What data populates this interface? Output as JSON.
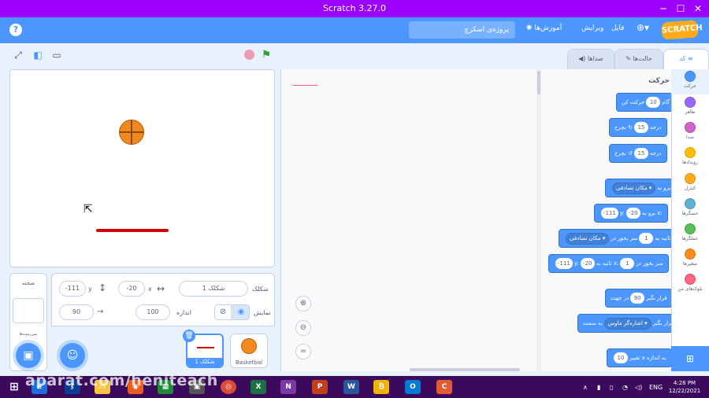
{
  "window": {
    "title": "Scratch 3.27.0",
    "minimize": "─",
    "maximize": "☐",
    "close": "✕"
  },
  "menu": {
    "help_icon": "?",
    "project_name": "پروژه‌ی اسکرچ",
    "tutorials": "آموزش‌ها",
    "edit": "ویرایش",
    "file": "فایل",
    "language_icon": "globe-icon",
    "logo": "SCRATCH"
  },
  "tabs": {
    "code": "کد",
    "costumes": "حالت‌ها",
    "sounds": "صداها"
  },
  "stage_controls": {
    "full_icon": "fullscreen-icon",
    "small_icon": "small-stage-icon",
    "large_icon": "large-stage-icon",
    "stop_icon": "stop-icon",
    "flag_icon": "green-flag-icon"
  },
  "sprite_info": {
    "sprite_label": "شکلک",
    "sprite_name": "شکلک 1",
    "x_label": "x",
    "x_value": "-20",
    "y_label": "y",
    "y_value": "-111",
    "show_label": "نمایش",
    "size_label": "اندازه",
    "size_value": "100",
    "direction_label": "جهت",
    "direction_value": "90"
  },
  "sprites": [
    {
      "name": "شکلک 1",
      "selected": true
    },
    {
      "name": "Basketbal",
      "selected": false
    }
  ],
  "stage_pane": {
    "label": "صحنه",
    "backdrops_label": "پس‌زمینه‌ها"
  },
  "category_header": "حرکت",
  "blocks": [
    {
      "pre": "حرکت کن",
      "pill": "10",
      "post": "گام"
    },
    {
      "pre": "بچرخ",
      "icon": "↻",
      "pill": "15",
      "post": "درجه"
    },
    {
      "pre": "بچرخ",
      "icon": "↺",
      "pill": "15",
      "post": "درجه"
    },
    {
      "pre": "برو به",
      "dd": "مکان تصادفی"
    },
    {
      "pre": "برو به x:",
      "pill": "-20",
      "mid": "y:",
      "pill2": "-111"
    },
    {
      "pre": "سر بخور در",
      "pill": "1",
      "mid": "ثانیه به",
      "dd": "مکان تصادفی"
    },
    {
      "pre": "سر بخور در",
      "pill": "1",
      "mid": "ثانیه به x:",
      "pill2": "-20",
      "mid2": "y:",
      "pill3": "-111"
    },
    {
      "pre": "در جهت",
      "pill": "90",
      "post": "قرار بگیر"
    },
    {
      "pre": "به سمت",
      "dd": "اشاره‌گر ماوس",
      "post": "قرار بگیر"
    },
    {
      "pre": "تغییر x به اندازه",
      "pill": "10"
    }
  ],
  "categories": [
    {
      "name": "حرکت",
      "color": "#4c97ff"
    },
    {
      "name": "ظاهر",
      "color": "#9966ff"
    },
    {
      "name": "صدا",
      "color": "#cf63cf"
    },
    {
      "name": "رویدادها",
      "color": "#ffbf00"
    },
    {
      "name": "کنترل",
      "color": "#ffab19"
    },
    {
      "name": "حسگرها",
      "color": "#5cb1d6"
    },
    {
      "name": "عملگرها",
      "color": "#59c059"
    },
    {
      "name": "متغیرها",
      "color": "#ff8c1a"
    },
    {
      "name": "بلوک‌های من",
      "color": "#ff6680"
    }
  ],
  "taskbar": {
    "time": "4:28 PM",
    "date": "12/22/2021",
    "lang": "ENG",
    "watermark": "aparat.com/heniteach"
  }
}
